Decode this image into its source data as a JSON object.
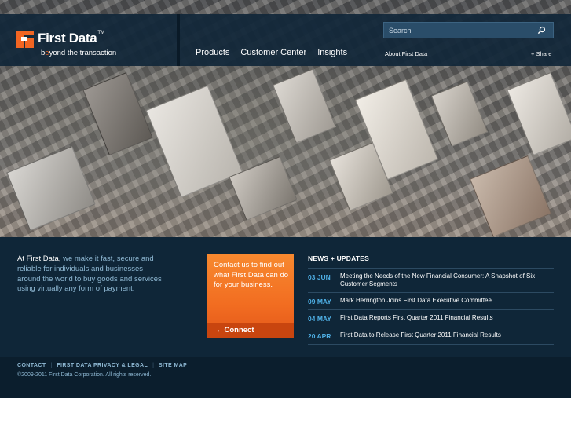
{
  "brand": {
    "name": "First Data",
    "trademark": "TM",
    "tagline_prefix": "b",
    "tagline_highlight": "e",
    "tagline_rest": "yond the transaction",
    "accent_color": "#f26522"
  },
  "search": {
    "placeholder": "Search",
    "icon": "search-icon"
  },
  "nav": {
    "items": [
      "Products",
      "Customer Center",
      "Insights"
    ],
    "about": "About First Data",
    "share": "+ Share"
  },
  "intro": {
    "lead": "At First Data,",
    "body": " we make it fast, secure and reliable for individuals and businesses around the world to buy goods and services using virtually any form of payment."
  },
  "cta": {
    "text": "Contact us to find out what First Data can do for your business.",
    "button": "Connect",
    "button_icon": "arrow-right-icon"
  },
  "news": {
    "title": "NEWS + UPDATES",
    "items": [
      {
        "date": "03 JUN",
        "text": "Meeting the Needs of the New Financial Consumer: A Snapshot of Six Customer Segments"
      },
      {
        "date": "09 MAY",
        "text": "Mark Herrington Joins First Data Executive Committee"
      },
      {
        "date": "04 MAY",
        "text": "First Data Reports First Quarter 2011 Financial Results"
      },
      {
        "date": "20 APR",
        "text": "First Data to Release First Quarter 2011 Financial Results"
      }
    ]
  },
  "footer": {
    "links": [
      "CONTACT",
      "FIRST DATA PRIVACY & LEGAL",
      "SITE MAP"
    ],
    "separator": "|",
    "copyright": "©2009-2011 First Data Corporation. All rights reserved."
  }
}
